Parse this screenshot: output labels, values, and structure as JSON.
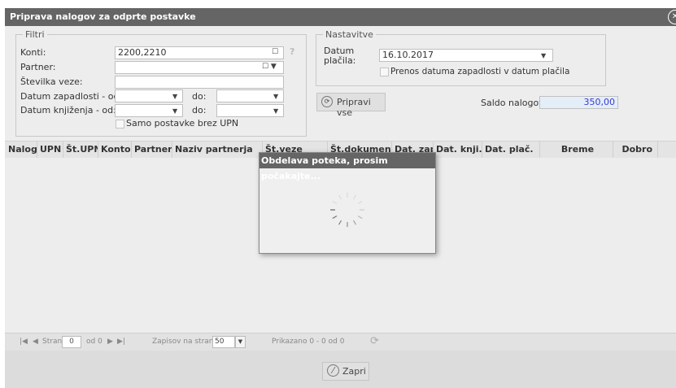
{
  "window": {
    "title": "Priprava nalogov za odprte postavke"
  },
  "filtri": {
    "legend": "Filtri",
    "konti_label": "Konti:",
    "konti_value": "2200,2210",
    "partner_label": "Partner:",
    "stevilka_label": "Številka veze:",
    "datum_zap_label": "Datum zapadlosti - od:",
    "datum_knj_label": "Datum knjiženja - od:",
    "do_label": "do:",
    "samo_label": "Samo postavke brez UPN",
    "help": "?"
  },
  "nastavitve": {
    "legend": "Nastavitve",
    "datum_label_1": "Datum",
    "datum_label_2": "plačila:",
    "datum_value": "16.10.2017",
    "prenos_label": "Prenos datuma zapadlosti v datum plačila"
  },
  "pripravi_label": "Pripravi vse",
  "saldo_label": "Saldo nalogov:",
  "saldo_value": "350,00",
  "columns": [
    "Nalog",
    "UPN",
    "Št.UPN",
    "Konto",
    "Partner",
    "Naziv partnerja",
    "Št.veze",
    "Št.dokumenta",
    "Dat. zap.",
    "Dat. knji.",
    "Dat. plač.",
    "Breme",
    "Dobro"
  ],
  "pager": {
    "stran_label": "Stran",
    "page_value": "0",
    "of_label": "od 0",
    "zapisov_label": "Zapisov na stran:",
    "per_page": "50",
    "prikazano": "Prikazano 0 - 0 od 0"
  },
  "zapri_label": "Zapri",
  "modal": {
    "title": "Obdelava poteka, prosim počakajte..."
  },
  "icons": {
    "close": "close-circle-icon",
    "refresh": "refresh-icon",
    "spinner": "loading-spinner-icon"
  },
  "colors": {
    "titlebar": "#656565",
    "saldo_text": "#3a3ad0",
    "saldo_bg": "#e3eef9"
  }
}
